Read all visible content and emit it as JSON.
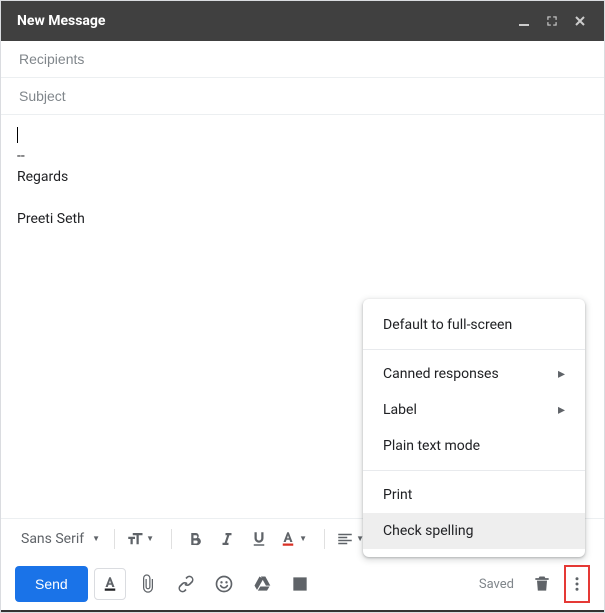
{
  "window": {
    "title": "New Message"
  },
  "compose": {
    "recipients_placeholder": "Recipients",
    "subject_placeholder": "Subject",
    "body_lines": [
      "",
      "--",
      "Regards",
      "",
      "Preeti Seth"
    ]
  },
  "format_toolbar": {
    "font": "Sans Serif"
  },
  "action_toolbar": {
    "send_label": "Send",
    "saved_label": "Saved"
  },
  "more_menu": {
    "items": [
      {
        "label": "Default to full-screen",
        "submenu": false
      },
      {
        "sep": true
      },
      {
        "label": "Canned responses",
        "submenu": true
      },
      {
        "label": "Label",
        "submenu": true
      },
      {
        "label": "Plain text mode",
        "submenu": false
      },
      {
        "sep": true
      },
      {
        "label": "Print",
        "submenu": false
      },
      {
        "label": "Check spelling",
        "submenu": false,
        "hovered": true
      }
    ]
  }
}
